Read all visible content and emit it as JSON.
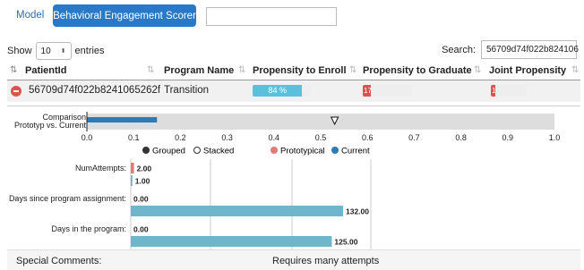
{
  "tabs": {
    "model": "Model",
    "scorer": "Behavioral Engagement Scorer"
  },
  "table_controls": {
    "show_label": "Show",
    "entries_value": "10",
    "entries_label": "entries",
    "search_label": "Search:",
    "search_value": "56709d74f022b824106"
  },
  "table": {
    "headers": [
      "PatientId",
      "Program Name",
      "Propensity to Enroll",
      "Propensity to Graduate",
      "Joint Propensity"
    ],
    "row": {
      "patient_id": "56709d74f022b8241065262f",
      "program": "Transition",
      "enroll_text": "84 %",
      "enroll_value": 0.84,
      "graduate_text": "17",
      "graduate_value": 0.17,
      "joint_text": "1",
      "joint_value": 0.12
    }
  },
  "comparison": {
    "label_line1": "Comparison",
    "label_line2": "Prototyp vs. Current",
    "current_value": 0.15,
    "prototypical_marker": 0.53,
    "ticks": [
      "0.0",
      "0.1",
      "0.2",
      "0.3",
      "0.4",
      "0.5",
      "0.6",
      "0.7",
      "0.8",
      "0.9",
      "1.0"
    ]
  },
  "legend": {
    "grouped": "Grouped",
    "stacked": "Stacked",
    "prototypical": "Prototypical",
    "current": "Current"
  },
  "colors": {
    "prototypical": "#e07b78",
    "current": "#6fb6cc",
    "current_dark": "#2c7bb6"
  },
  "chart_data": {
    "type": "bar",
    "orientation": "horizontal",
    "mode": "grouped",
    "categories": [
      "NumAttempts:",
      "Days since program assignment:",
      "Days in the program:"
    ],
    "series": [
      {
        "name": "Prototypical",
        "values": [
          2.0,
          0.0,
          0.0
        ],
        "labels": [
          "2.00",
          "0.00",
          "0.00"
        ]
      },
      {
        "name": "Current",
        "values": [
          1.0,
          132.0,
          125.0
        ],
        "labels": [
          "1.00",
          "132.00",
          "125.00"
        ]
      }
    ],
    "xlim": [
      0,
      132
    ]
  },
  "footer": {
    "label": "Special Comments:",
    "value": "Requires many attempts"
  }
}
